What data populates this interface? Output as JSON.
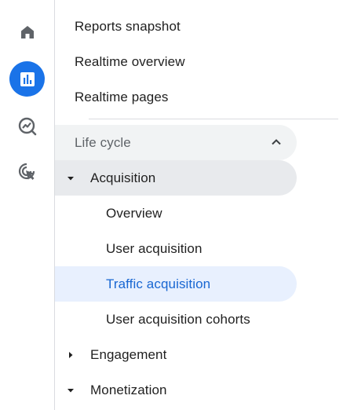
{
  "rail": {
    "icons": [
      {
        "name": "home-icon",
        "active": false
      },
      {
        "name": "reports-icon",
        "active": true
      },
      {
        "name": "explore-icon",
        "active": false
      },
      {
        "name": "advertising-icon",
        "active": false
      }
    ],
    "accent_color": "#1a73e8"
  },
  "nav": {
    "top_items": [
      {
        "label": "Reports snapshot"
      },
      {
        "label": "Realtime overview"
      },
      {
        "label": "Realtime pages"
      }
    ],
    "section": {
      "label": "Life cycle",
      "expanded": true
    },
    "acquisition": {
      "label": "Acquisition",
      "expanded": true,
      "children": [
        {
          "label": "Overview",
          "selected": false
        },
        {
          "label": "User acquisition",
          "selected": false
        },
        {
          "label": "Traffic acquisition",
          "selected": true
        },
        {
          "label": "User acquisition cohorts",
          "selected": false
        }
      ]
    },
    "engagement": {
      "label": "Engagement",
      "expanded": false
    },
    "monetization": {
      "label": "Monetization",
      "expanded": true
    },
    "selected_color": "#1967d2"
  }
}
